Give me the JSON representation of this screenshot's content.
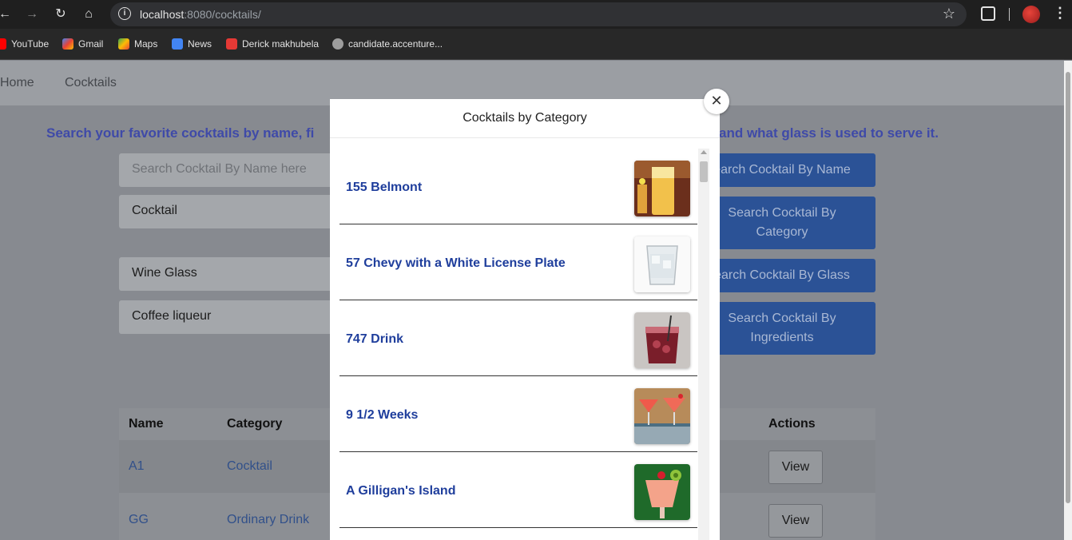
{
  "browser": {
    "url_host": "localhost",
    "url_rest": ":8080/cocktails/",
    "bookmarks": [
      {
        "label": "YouTube",
        "color": "#ff0000"
      },
      {
        "label": "Gmail",
        "color": "#ea4335"
      },
      {
        "label": "Maps",
        "color": "#34a853"
      },
      {
        "label": "News",
        "color": "#4285f4"
      },
      {
        "label": "Derick makhubela",
        "color": "#e53935"
      },
      {
        "label": "candidate.accenture...",
        "color": "#9e9e9e"
      }
    ]
  },
  "navbar": {
    "home": "Home",
    "cocktails": "Cocktails"
  },
  "page": {
    "headline_left": "Search your favorite cocktails by name, fi",
    "headline_right": "and what glass is used to serve it.",
    "search_placeholder": "Search Cocktail By Name here",
    "category_value": "Cocktail",
    "glass_value": "Wine Glass",
    "ingredient_value": "Coffee liqueur",
    "buttons": {
      "by_name": "earch Cocktail By Name",
      "by_category": "Search Cocktail By Category",
      "by_glass": "earch Cocktail By Glass",
      "by_ingredients": "Search Cocktail By Ingredients"
    },
    "table": {
      "headers": {
        "name": "Name",
        "category": "Category",
        "actions": "Actions"
      },
      "rows": [
        {
          "name": "A1",
          "category": "Cocktail",
          "action": "View"
        },
        {
          "name": "GG",
          "category": "Ordinary Drink",
          "action": "View"
        }
      ]
    }
  },
  "modal": {
    "title": "Cocktails by Category",
    "close": "✕",
    "items": [
      {
        "name": "155 Belmont"
      },
      {
        "name": "57 Chevy with a White License Plate"
      },
      {
        "name": "747 Drink"
      },
      {
        "name": "9 1/2 Weeks"
      },
      {
        "name": "A Gilligan's Island"
      }
    ]
  }
}
